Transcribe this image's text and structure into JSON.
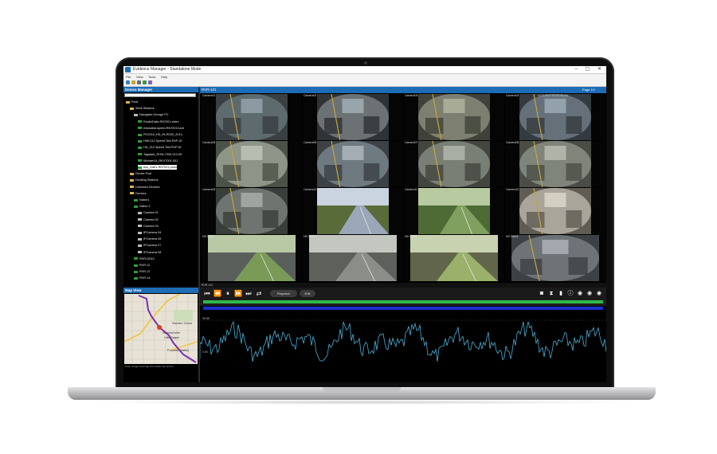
{
  "window": {
    "title": "Evidence Manager - Standalone Mode",
    "controls": "– ▢ ✕"
  },
  "menu": [
    "File",
    "View",
    "Tools",
    "Help"
  ],
  "device_manager": {
    "title": "Device Manager",
    "tree": [
      {
        "label": "Root",
        "icon": "folder-icon",
        "indent": 0
      },
      {
        "label": "Work Stations",
        "icon": "folder-icon",
        "indent": 1
      },
      {
        "label": "Navigator-George PC",
        "icon": "monitor-icon",
        "indent": 2
      },
      {
        "label": "Route/Date-RN7001.video",
        "icon": "dvr-icon",
        "indent": 3
      },
      {
        "label": "extradata-speed-RN7001Card",
        "icon": "dvr-icon",
        "indent": 3
      },
      {
        "label": "PC2016_HD_IN-RD32_2014",
        "icon": "dvr-icon",
        "indent": 3
      },
      {
        "label": "HWL212 Speed Test RVP-ID",
        "icon": "dvr-icon",
        "indent": 3
      },
      {
        "label": "HD_212 Speed Test RVP-ID",
        "icon": "dvr-icon",
        "indent": 3
      },
      {
        "label": "Tagstant_RHW-7000-013-05",
        "icon": "dvr-icon",
        "indent": 3
      },
      {
        "label": "Michael14_RKV7001-001",
        "icon": "dvr-icon",
        "indent": 3
      },
      {
        "label": "bus_mall1-RN7001.pano",
        "icon": "dvr-icon",
        "indent": 3,
        "selected": true
      },
      {
        "label": "Device Pool",
        "icon": "folder-icon",
        "indent": 1
      },
      {
        "label": "Docking Stations",
        "icon": "folder-icon",
        "indent": 1
      },
      {
        "label": "Unknown Devices",
        "icon": "folder-icon",
        "indent": 1
      },
      {
        "label": "Devices",
        "icon": "folder-icon",
        "indent": 1
      },
      {
        "label": "Nabor1",
        "icon": "dvr-icon",
        "indent": 2
      },
      {
        "label": "Nabor 2",
        "icon": "dvr-icon",
        "indent": 2
      },
      {
        "label": "Camera 01",
        "icon": "camera-icon",
        "indent": 3
      },
      {
        "label": "Camera 02",
        "icon": "camera-icon",
        "indent": 3
      },
      {
        "label": "Camera 03",
        "icon": "camera-icon",
        "indent": 3
      },
      {
        "label": "IPCamera 04",
        "icon": "camera-icon",
        "indent": 3
      },
      {
        "label": "IPCamera 05",
        "icon": "camera-icon",
        "indent": 3
      },
      {
        "label": "IPCamera 07",
        "icon": "camera-icon",
        "indent": 3
      },
      {
        "label": "IPCamera 08",
        "icon": "camera-icon",
        "indent": 3
      },
      {
        "label": "RVR-DD12",
        "icon": "dvr-icon",
        "indent": 2
      },
      {
        "label": "RVR-11",
        "icon": "dvr-icon",
        "indent": 2
      },
      {
        "label": "RVR-12",
        "icon": "dvr-icon",
        "indent": 2
      },
      {
        "label": "RVR-14",
        "icon": "dvr-icon",
        "indent": 2
      }
    ]
  },
  "map_view": {
    "title": "Map View",
    "place_labels": [
      "Garden Grove",
      "Westminster",
      "Little Saigon",
      "Fountain Valley"
    ],
    "footer": "Data, images and map information are shown"
  },
  "video": {
    "header_label": "RVR-121",
    "page_label": "Page 1/1",
    "display_label": "Display",
    "timestamp": "11/21/2017 07:21:40 AM",
    "cameras": [
      "Camera01",
      "Camera02",
      "Camera03",
      "Camera04",
      "Camera05",
      "Camera06",
      "Camera07",
      "Camera08",
      "Camera09",
      "Camera10",
      "Camera11",
      "Camera12",
      "HD Cam1",
      "HD Cam2",
      "HD Cam3",
      "HD Cam4"
    ]
  },
  "playback": {
    "status_label": "RVR-121",
    "playback_label": "Playback",
    "edit_label": "Edit",
    "y_labels": [
      "59.88",
      "0.00"
    ]
  },
  "colors": {
    "accent": "#1d6cb5",
    "timeline_green": "#2eb84a",
    "timeline_blue": "#1a2fd0",
    "waveform": "#4ab0d8"
  }
}
